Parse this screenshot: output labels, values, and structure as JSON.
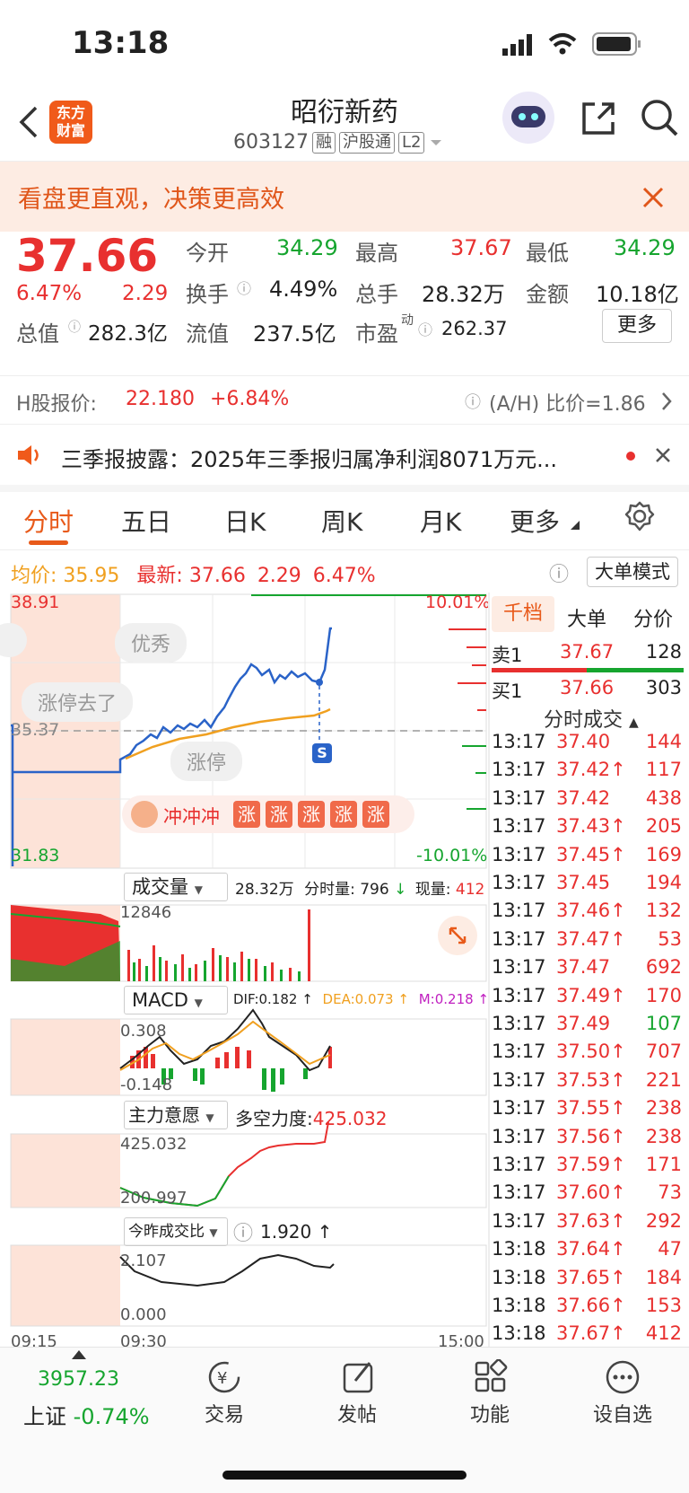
{
  "status": {
    "time": "13:18"
  },
  "header": {
    "logo": "东方\n财富",
    "title": "昭衍新药",
    "code": "603127",
    "tags": [
      "融",
      "沪股通",
      "L2"
    ]
  },
  "banner": {
    "text": "看盘更直观，决策更高效"
  },
  "quote": {
    "price": "37.66",
    "pct": "6.47%",
    "chg": "2.29",
    "open_label": "今开",
    "open": "34.29",
    "high_label": "最高",
    "high": "37.67",
    "low_label": "最低",
    "low": "34.29",
    "turnover_label": "换手",
    "turnover": "4.49%",
    "volume_label": "总手",
    "volume": "28.32万",
    "amount_label": "金额",
    "amount": "10.18亿",
    "mcap_label": "总值",
    "mcap": "282.3亿",
    "float_label": "流值",
    "float": "237.5亿",
    "pe_label": "市盈",
    "pe_sup": "动",
    "pe": "262.37",
    "more": "更多"
  },
  "hshare": {
    "label": "H股报价:",
    "price": "22.180",
    "pct": "+6.84%",
    "ratio": "(A/H) 比价=1.86"
  },
  "news": {
    "text": "三季报披露：2025年三季报归属净利润8071万元..."
  },
  "tabs": [
    "分时",
    "五日",
    "日K",
    "周K",
    "月K",
    "更多"
  ],
  "avgline": {
    "avg_label": "均价:",
    "avg": "35.95",
    "last_label": "最新:",
    "last": "37.66",
    "chg": "2.29",
    "pct": "6.47%",
    "mode": "大单模式"
  },
  "chart": {
    "ymax": "38.91",
    "ymid": "35.37",
    "ymin": "31.83",
    "pmax": "10.01%",
    "pmin": "-10.01%",
    "bubbles": [
      "优秀",
      "涨停去了",
      "涨停"
    ],
    "rush": "冲冲冲",
    "rush_tag": "涨",
    "marker": "S"
  },
  "volume": {
    "label": "成交量",
    "total": "28.32万",
    "minvol_label": "分时量:",
    "minvol": "796",
    "now_label": "现量:",
    "now": "412",
    "peak": "12846"
  },
  "macd": {
    "label": "MACD",
    "dif": "DIF:0.182",
    "dea": "DEA:0.073",
    "m": "M:0.218",
    "top": "0.308",
    "bottom": "-0.148"
  },
  "force": {
    "label": "主力意愿",
    "value_label": "多空力度:",
    "value": "425.032",
    "top": "425.032",
    "bottom": "200.997"
  },
  "ratio": {
    "label": "今昨成交比",
    "value": "1.920",
    "top": "2.107",
    "bottom": "0.000"
  },
  "timeaxis": [
    "09:15",
    "09:30",
    "15:00"
  ],
  "orderbook": {
    "tabs": [
      "千档",
      "大单",
      "分价"
    ],
    "sell1": {
      "label": "卖1",
      "price": "37.67",
      "vol": "128"
    },
    "buy1": {
      "label": "买1",
      "price": "37.66",
      "vol": "303"
    },
    "trades_title": "分时成交"
  },
  "trades": [
    {
      "t": "13:17",
      "p": "37.40",
      "v": "144",
      "vc": "red"
    },
    {
      "t": "13:17",
      "p": "37.42↑",
      "v": "117",
      "vc": "red"
    },
    {
      "t": "13:17",
      "p": "37.42",
      "v": "438",
      "vc": "red"
    },
    {
      "t": "13:17",
      "p": "37.43↑",
      "v": "205",
      "vc": "red"
    },
    {
      "t": "13:17",
      "p": "37.45↑",
      "v": "169",
      "vc": "red"
    },
    {
      "t": "13:17",
      "p": "37.45",
      "v": "194",
      "vc": "red"
    },
    {
      "t": "13:17",
      "p": "37.46↑",
      "v": "132",
      "vc": "red"
    },
    {
      "t": "13:17",
      "p": "37.47↑",
      "v": "53",
      "vc": "red"
    },
    {
      "t": "13:17",
      "p": "37.47",
      "v": "692",
      "vc": "red"
    },
    {
      "t": "13:17",
      "p": "37.49↑",
      "v": "170",
      "vc": "red"
    },
    {
      "t": "13:17",
      "p": "37.49",
      "v": "107",
      "vc": "green"
    },
    {
      "t": "13:17",
      "p": "37.50↑",
      "v": "707",
      "vc": "red"
    },
    {
      "t": "13:17",
      "p": "37.53↑",
      "v": "221",
      "vc": "red"
    },
    {
      "t": "13:17",
      "p": "37.55↑",
      "v": "238",
      "vc": "red"
    },
    {
      "t": "13:17",
      "p": "37.56↑",
      "v": "238",
      "vc": "red"
    },
    {
      "t": "13:17",
      "p": "37.59↑",
      "v": "171",
      "vc": "red"
    },
    {
      "t": "13:17",
      "p": "37.60↑",
      "v": "73",
      "vc": "red"
    },
    {
      "t": "13:17",
      "p": "37.63↑",
      "v": "292",
      "vc": "red"
    },
    {
      "t": "13:18",
      "p": "37.64↑",
      "v": "47",
      "vc": "red"
    },
    {
      "t": "13:18",
      "p": "37.65↑",
      "v": "184",
      "vc": "red"
    },
    {
      "t": "13:18",
      "p": "37.66↑",
      "v": "153",
      "vc": "red"
    },
    {
      "t": "13:18",
      "p": "37.67↑",
      "v": "412",
      "vc": "red"
    }
  ],
  "bottom": {
    "index_value": "3957.23",
    "index_name": "上证",
    "index_pct": "-0.74%",
    "items": [
      "交易",
      "发帖",
      "功能",
      "设自选"
    ]
  }
}
